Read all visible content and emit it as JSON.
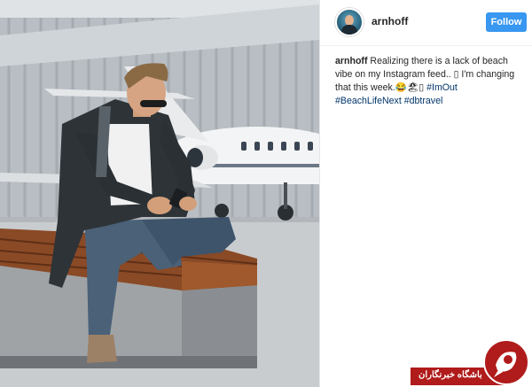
{
  "post": {
    "username": "arnhoff",
    "follow_label": "Follow",
    "caption": {
      "username": "arnhoff",
      "text": " Realizing there is a lack of beach vibe on my Instagram feed.. ▯ I'm changing that this week.😂🏖▯ ",
      "tags": [
        "#ImOut",
        "#BeachLifeNext",
        "#dbtravel"
      ]
    }
  },
  "image": {
    "subject": "man-sitting-on-bench-near-private-jet"
  },
  "watermark": {
    "text": "باشگاه خبرنگاران"
  },
  "colors": {
    "follow_button": "#3897f0",
    "hashtag": "#003569",
    "watermark_red": "#b01b1b"
  }
}
